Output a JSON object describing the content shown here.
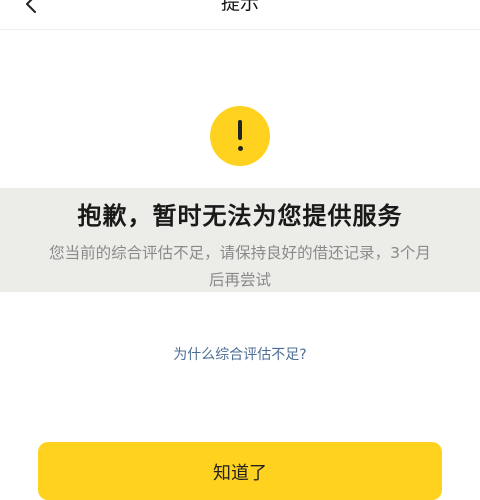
{
  "nav": {
    "title": "提示"
  },
  "alert": {
    "icon": "exclamation-icon",
    "color": "#ffd21f"
  },
  "message": {
    "title": "抱歉，暂时无法为您提供服务",
    "description": "您当前的综合评估不足，请保持良好的借还记录，3个月后再尝试"
  },
  "help": {
    "link_label": "为什么综合评估不足?"
  },
  "footer": {
    "confirm_label": "知道了",
    "button_color": "#ffd21f"
  }
}
